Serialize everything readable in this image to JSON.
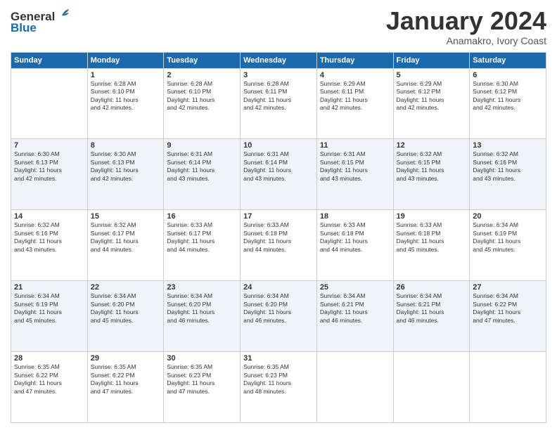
{
  "header": {
    "logo": {
      "line1": "General",
      "line2": "Blue"
    },
    "month_title": "January 2024",
    "subtitle": "Anamakro, Ivory Coast"
  },
  "days_of_week": [
    "Sunday",
    "Monday",
    "Tuesday",
    "Wednesday",
    "Thursday",
    "Friday",
    "Saturday"
  ],
  "weeks": [
    [
      {
        "day": "",
        "info": ""
      },
      {
        "day": "1",
        "info": "Sunrise: 6:28 AM\nSunset: 6:10 PM\nDaylight: 11 hours\nand 42 minutes."
      },
      {
        "day": "2",
        "info": "Sunrise: 6:28 AM\nSunset: 6:10 PM\nDaylight: 11 hours\nand 42 minutes."
      },
      {
        "day": "3",
        "info": "Sunrise: 6:28 AM\nSunset: 6:11 PM\nDaylight: 11 hours\nand 42 minutes."
      },
      {
        "day": "4",
        "info": "Sunrise: 6:29 AM\nSunset: 6:11 PM\nDaylight: 11 hours\nand 42 minutes."
      },
      {
        "day": "5",
        "info": "Sunrise: 6:29 AM\nSunset: 6:12 PM\nDaylight: 11 hours\nand 42 minutes."
      },
      {
        "day": "6",
        "info": "Sunrise: 6:30 AM\nSunset: 6:12 PM\nDaylight: 11 hours\nand 42 minutes."
      }
    ],
    [
      {
        "day": "7",
        "info": "Sunrise: 6:30 AM\nSunset: 6:13 PM\nDaylight: 11 hours\nand 42 minutes."
      },
      {
        "day": "8",
        "info": "Sunrise: 6:30 AM\nSunset: 6:13 PM\nDaylight: 11 hours\nand 42 minutes."
      },
      {
        "day": "9",
        "info": "Sunrise: 6:31 AM\nSunset: 6:14 PM\nDaylight: 11 hours\nand 43 minutes."
      },
      {
        "day": "10",
        "info": "Sunrise: 6:31 AM\nSunset: 6:14 PM\nDaylight: 11 hours\nand 43 minutes."
      },
      {
        "day": "11",
        "info": "Sunrise: 6:31 AM\nSunset: 6:15 PM\nDaylight: 11 hours\nand 43 minutes."
      },
      {
        "day": "12",
        "info": "Sunrise: 6:32 AM\nSunset: 6:15 PM\nDaylight: 11 hours\nand 43 minutes."
      },
      {
        "day": "13",
        "info": "Sunrise: 6:32 AM\nSunset: 6:16 PM\nDaylight: 11 hours\nand 43 minutes."
      }
    ],
    [
      {
        "day": "14",
        "info": "Sunrise: 6:32 AM\nSunset: 6:16 PM\nDaylight: 11 hours\nand 43 minutes."
      },
      {
        "day": "15",
        "info": "Sunrise: 6:32 AM\nSunset: 6:17 PM\nDaylight: 11 hours\nand 44 minutes."
      },
      {
        "day": "16",
        "info": "Sunrise: 6:33 AM\nSunset: 6:17 PM\nDaylight: 11 hours\nand 44 minutes."
      },
      {
        "day": "17",
        "info": "Sunrise: 6:33 AM\nSunset: 6:18 PM\nDaylight: 11 hours\nand 44 minutes."
      },
      {
        "day": "18",
        "info": "Sunrise: 6:33 AM\nSunset: 6:18 PM\nDaylight: 11 hours\nand 44 minutes."
      },
      {
        "day": "19",
        "info": "Sunrise: 6:33 AM\nSunset: 6:18 PM\nDaylight: 11 hours\nand 45 minutes."
      },
      {
        "day": "20",
        "info": "Sunrise: 6:34 AM\nSunset: 6:19 PM\nDaylight: 11 hours\nand 45 minutes."
      }
    ],
    [
      {
        "day": "21",
        "info": "Sunrise: 6:34 AM\nSunset: 6:19 PM\nDaylight: 11 hours\nand 45 minutes."
      },
      {
        "day": "22",
        "info": "Sunrise: 6:34 AM\nSunset: 6:20 PM\nDaylight: 11 hours\nand 45 minutes."
      },
      {
        "day": "23",
        "info": "Sunrise: 6:34 AM\nSunset: 6:20 PM\nDaylight: 11 hours\nand 46 minutes."
      },
      {
        "day": "24",
        "info": "Sunrise: 6:34 AM\nSunset: 6:20 PM\nDaylight: 11 hours\nand 46 minutes."
      },
      {
        "day": "25",
        "info": "Sunrise: 6:34 AM\nSunset: 6:21 PM\nDaylight: 11 hours\nand 46 minutes."
      },
      {
        "day": "26",
        "info": "Sunrise: 6:34 AM\nSunset: 6:21 PM\nDaylight: 11 hours\nand 46 minutes."
      },
      {
        "day": "27",
        "info": "Sunrise: 6:34 AM\nSunset: 6:22 PM\nDaylight: 11 hours\nand 47 minutes."
      }
    ],
    [
      {
        "day": "28",
        "info": "Sunrise: 6:35 AM\nSunset: 6:22 PM\nDaylight: 11 hours\nand 47 minutes."
      },
      {
        "day": "29",
        "info": "Sunrise: 6:35 AM\nSunset: 6:22 PM\nDaylight: 11 hours\nand 47 minutes."
      },
      {
        "day": "30",
        "info": "Sunrise: 6:35 AM\nSunset: 6:23 PM\nDaylight: 11 hours\nand 47 minutes."
      },
      {
        "day": "31",
        "info": "Sunrise: 6:35 AM\nSunset: 6:23 PM\nDaylight: 11 hours\nand 48 minutes."
      },
      {
        "day": "",
        "info": ""
      },
      {
        "day": "",
        "info": ""
      },
      {
        "day": "",
        "info": ""
      }
    ]
  ]
}
